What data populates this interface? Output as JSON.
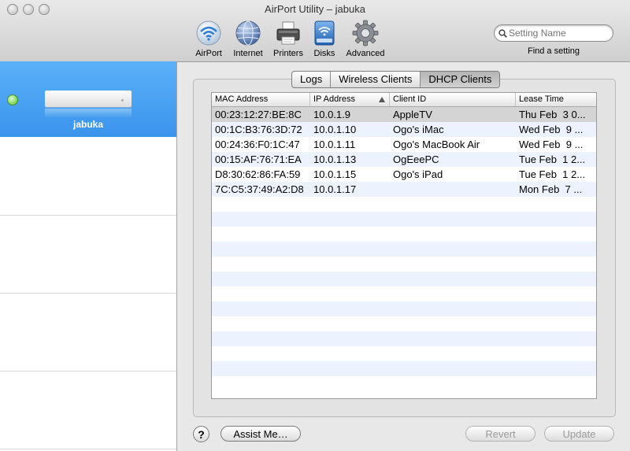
{
  "window": {
    "title": "AirPort Utility – jabuka"
  },
  "toolbar": {
    "items": [
      {
        "label": "AirPort",
        "icon": "airport-wifi-icon"
      },
      {
        "label": "Internet",
        "icon": "globe-icon"
      },
      {
        "label": "Printers",
        "icon": "printer-icon"
      },
      {
        "label": "Disks",
        "icon": "disk-icon"
      },
      {
        "label": "Advanced",
        "icon": "gear-icon"
      }
    ],
    "search": {
      "placeholder": "Setting Name",
      "label": "Find a setting"
    }
  },
  "sidebar": {
    "device": {
      "name": "jabuka",
      "status_color": "#53c22a"
    }
  },
  "tabs": [
    {
      "label": "Logs",
      "selected": false
    },
    {
      "label": "Wireless Clients",
      "selected": false
    },
    {
      "label": "DHCP Clients",
      "selected": true
    }
  ],
  "table": {
    "columns": [
      "MAC Address",
      "IP Address",
      "Client ID",
      "Lease Time"
    ],
    "sort_column": "IP Address",
    "rows": [
      [
        "00:23:12:27:BE:8C",
        "10.0.1.9",
        "AppleTV",
        "Thu Feb  3 0..."
      ],
      [
        "00:1C:B3:76:3D:72",
        "10.0.1.10",
        "Ogo's iMac",
        "Wed Feb  9 ..."
      ],
      [
        "00:24:36:F0:1C:47",
        "10.0.1.11",
        "Ogo's MacBook Air",
        "Wed Feb  9 ..."
      ],
      [
        "00:15:AF:76:71:EA",
        "10.0.1.13",
        "OgEeePC",
        "Tue Feb  1 2..."
      ],
      [
        "D8:30:62:86:FA:59",
        "10.0.1.15",
        "Ogo's iPad",
        "Tue Feb  1 2..."
      ],
      [
        "7C:C5:37:49:A2:D8",
        "10.0.1.17",
        "",
        "Mon Feb  7 ..."
      ]
    ]
  },
  "buttons": {
    "help": "?",
    "assist": "Assist Me…",
    "revert": "Revert",
    "update": "Update"
  },
  "colors": {
    "sidebar_selected": "#4aa3f2",
    "row_alt": "#edf3fe",
    "row_selected": "#d4d4d4"
  }
}
